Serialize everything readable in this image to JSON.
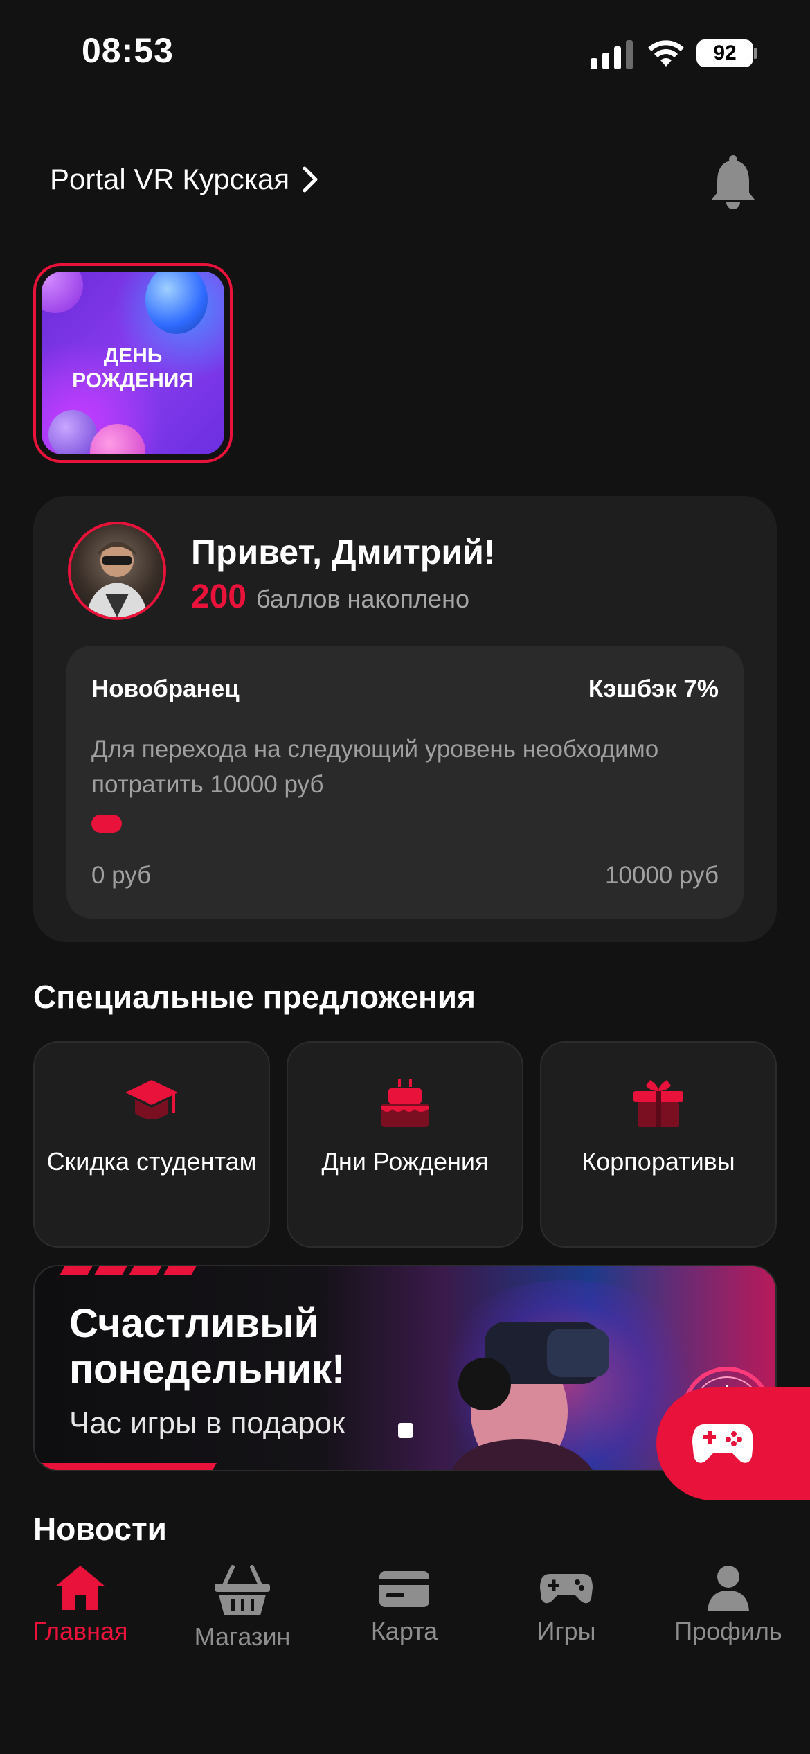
{
  "status_bar": {
    "time": "08:53",
    "battery": "92"
  },
  "header": {
    "location": "Portal VR Курская"
  },
  "story": {
    "title_line1": "ДЕНЬ",
    "title_line2": "РОЖДЕНИЯ"
  },
  "profile": {
    "greeting": "Привет, Дмитрий!",
    "points_value": "200",
    "points_label": "баллов накоплено",
    "level_name": "Новобранец",
    "cashback": "Кэшбэк 7%",
    "level_description": "Для перехода на следующий уровень необходимо потратить 10000 руб",
    "progress_fraction": 0.0,
    "range_min": "0 руб",
    "range_max": "10000 руб"
  },
  "offers": {
    "title": "Специальные предложения",
    "items": [
      {
        "label": "Скидка студентам",
        "icon": "graduation-cap-icon"
      },
      {
        "label": "Дни Рождения",
        "icon": "cake-icon"
      },
      {
        "label": "Корпоративы",
        "icon": "gift-icon"
      }
    ]
  },
  "banner": {
    "title": "Счастливый понедельник!",
    "subtitle": "Час игры в подарок"
  },
  "news": {
    "title": "Новости"
  },
  "nav": {
    "items": [
      {
        "label": "Главная",
        "icon": "home-icon",
        "active": true
      },
      {
        "label": "Магазин",
        "icon": "basket-icon"
      },
      {
        "label": "Карта",
        "icon": "card-icon"
      },
      {
        "label": "Игры",
        "icon": "gamepad-icon"
      },
      {
        "label": "Профиль",
        "icon": "person-icon"
      }
    ]
  },
  "colors": {
    "accent": "#e8123a",
    "background": "#121212",
    "card": "#1e1e1e"
  }
}
